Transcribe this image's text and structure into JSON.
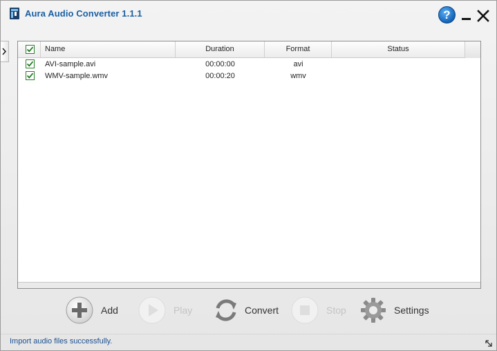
{
  "window": {
    "title": "Aura Audio Converter 1.1.1",
    "help_glyph": "?",
    "icons": {
      "app": "app-logo-icon",
      "help": "help-icon",
      "minimize": "minimize-icon",
      "close": "close-icon",
      "side": "chevron-right-icon"
    }
  },
  "table": {
    "columns": {
      "name": "Name",
      "duration": "Duration",
      "format": "Format",
      "status": "Status"
    },
    "rows": [
      {
        "checked": true,
        "name": "AVI-sample.avi",
        "duration": "00:00:00",
        "format": "avi",
        "status": ""
      },
      {
        "checked": true,
        "name": "WMV-sample.wmv",
        "duration": "00:00:20",
        "format": "wmv",
        "status": ""
      }
    ]
  },
  "toolbar": {
    "add_label": "Add",
    "play_label": "Play",
    "convert_label": "Convert",
    "stop_label": "Stop",
    "settings_label": "Settings",
    "disabled": [
      "play",
      "stop"
    ]
  },
  "status": {
    "message": "Import audio files successfully."
  },
  "colors": {
    "title": "#1a5fa3",
    "status_text": "#1a4f8f",
    "checkbox": "#2a7e2a",
    "disabled_label": "#c4c4c4"
  }
}
